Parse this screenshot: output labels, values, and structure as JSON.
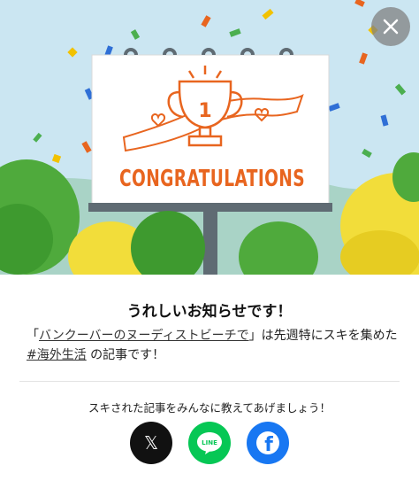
{
  "modal": {
    "headline": "うれしいお知らせです！",
    "message_prefix": "「",
    "article_title": "バンクーバーのヌーディストビーチで",
    "message_middle": "」は先週特にスキを集めた ",
    "hashtag": "#海外生活",
    "message_suffix": " の記事です！",
    "share_prompt": "スキされた記事をみんなに教えてあげましょう！",
    "close_icon": "close-icon"
  },
  "billboard": {
    "text": "CONGRATULATIONS",
    "trophy_number": "1"
  },
  "share": {
    "x_glyph": "𝕏",
    "line_label": "LINE",
    "facebook_glyph": "f"
  },
  "colors": {
    "sky": "#cbe6f2",
    "accent_orange": "#e8651f",
    "x_bg": "#111111",
    "line_bg": "#06c755",
    "facebook_bg": "#1877f2",
    "close_bg": "#8a8a8a"
  }
}
